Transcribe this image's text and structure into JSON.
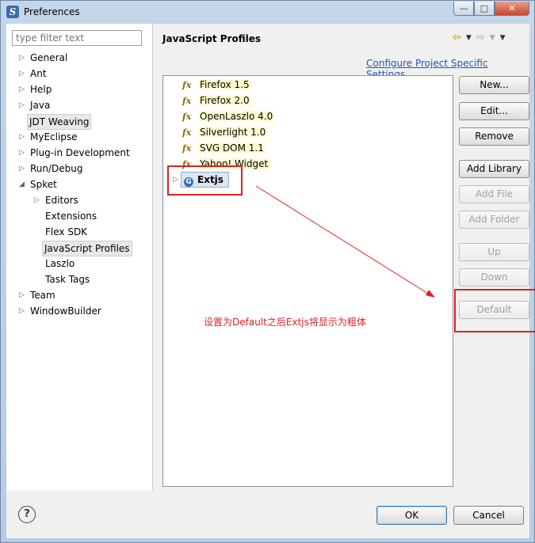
{
  "window": {
    "title": "Preferences",
    "min": "—",
    "max": "□",
    "close": "✕",
    "app_icon": "S"
  },
  "filter": {
    "placeholder": "type filter text"
  },
  "tree": [
    {
      "label": "General",
      "arrow": "▷"
    },
    {
      "label": "Ant",
      "arrow": "▷"
    },
    {
      "label": "Help",
      "arrow": "▷"
    },
    {
      "label": "Java",
      "arrow": "▷"
    },
    {
      "label": "JDT Weaving",
      "arrow": ""
    },
    {
      "label": "MyEclipse",
      "arrow": "▷"
    },
    {
      "label": "Plug-in Development",
      "arrow": "▷"
    },
    {
      "label": "Run/Debug",
      "arrow": "▷"
    },
    {
      "label": "Spket",
      "arrow": "◢"
    },
    {
      "label": "Editors",
      "arrow": "▷"
    },
    {
      "label": "Extensions",
      "arrow": ""
    },
    {
      "label": "Flex SDK",
      "arrow": ""
    },
    {
      "label": "JavaScript Profiles",
      "arrow": ""
    },
    {
      "label": "Laszlo",
      "arrow": ""
    },
    {
      "label": "Task Tags",
      "arrow": ""
    },
    {
      "label": "Team",
      "arrow": "▷"
    },
    {
      "label": "WindowBuilder",
      "arrow": "▷"
    }
  ],
  "page": {
    "title": "JavaScript Profiles",
    "configure_link": "Configure Project Specific Settings...",
    "nav": {
      "back": "⇦",
      "forward": "⇨",
      "dropdown": "▼",
      "menu": "▼"
    }
  },
  "profiles": [
    {
      "icon": "function-icon",
      "glyph": "fx",
      "label": "Firefox 1.5"
    },
    {
      "icon": "function-icon",
      "glyph": "fx",
      "label": "Firefox 2.0"
    },
    {
      "icon": "function-icon",
      "glyph": "fx",
      "label": "OpenLaszlo 4.0"
    },
    {
      "icon": "function-icon",
      "glyph": "fx",
      "label": "Silverlight 1.0"
    },
    {
      "icon": "function-icon",
      "glyph": "fx",
      "label": "SVG DOM 1.1"
    },
    {
      "icon": "function-icon",
      "glyph": "fx",
      "label": "Yahoo! Widget"
    }
  ],
  "custom_profile": {
    "label": "Extjs",
    "icon": "globe-icon",
    "glyph": "G",
    "arrow": "▷"
  },
  "annotation": {
    "text": "设置为Default之后Extjs将显示为粗体",
    "color": "#e02020"
  },
  "buttons": {
    "new": "New...",
    "edit": "Edit...",
    "remove": "Remove",
    "add_library": "Add Library",
    "add_file": "Add File",
    "add_folder": "Add Folder",
    "up": "Up",
    "down": "Down",
    "default": "Default"
  },
  "footer": {
    "help": "?",
    "ok": "OK",
    "cancel": "Cancel"
  }
}
